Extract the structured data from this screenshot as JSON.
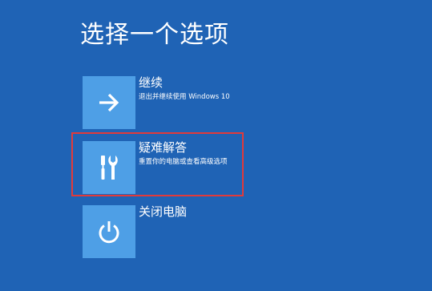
{
  "page": {
    "title": "选择一个选项",
    "background_color": "#1f63b5",
    "tile_color": "#4e9fe6",
    "highlight_color": "#e23a3a"
  },
  "options": [
    {
      "label": "继续",
      "description": "退出并继续使用 Windows 10",
      "icon": "arrow-right-icon"
    },
    {
      "label": "疑难解答",
      "description": "重置你的电脑或查看高级选项",
      "icon": "tools-icon",
      "highlighted": true
    },
    {
      "label": "关闭电脑",
      "description": "",
      "icon": "power-icon"
    }
  ]
}
